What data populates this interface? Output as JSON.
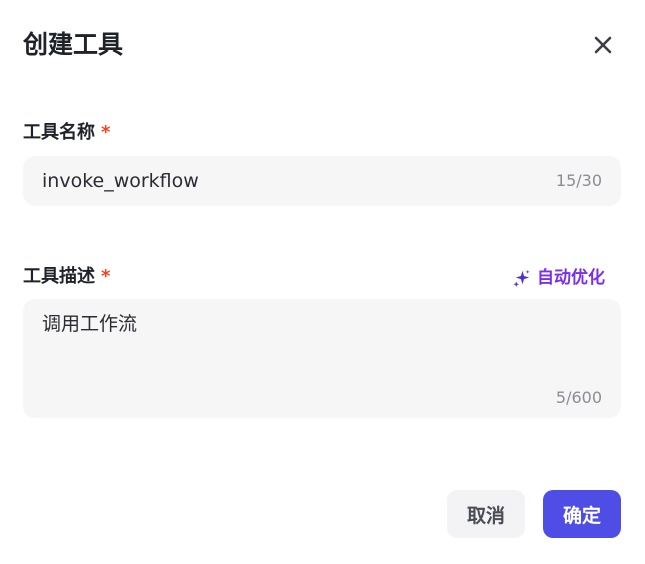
{
  "dialog": {
    "title": "创建工具",
    "close_icon": "close-icon"
  },
  "fields": {
    "name": {
      "label": "工具名称",
      "required_mark": "*",
      "value": "invoke_workflow",
      "counter": "15/30"
    },
    "description": {
      "label": "工具描述",
      "required_mark": "*",
      "value": "调用工作流",
      "counter": "5/600",
      "auto_optimize_label": "自动优化",
      "auto_optimize_icon": "sparkle-icon"
    }
  },
  "footer": {
    "cancel_label": "取消",
    "confirm_label": "确定"
  },
  "colors": {
    "accent": "#4e4ee6",
    "required": "#f0441d",
    "auto_optimize": "#7a2fe8",
    "input_bg": "#f6f6f7"
  }
}
